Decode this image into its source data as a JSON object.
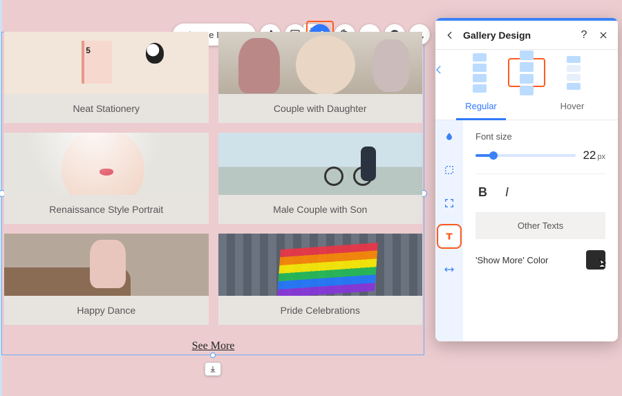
{
  "toolbar": {
    "change_images": "Change Images"
  },
  "gallery": {
    "items": [
      {
        "caption": "Neat Stationery"
      },
      {
        "caption": "Couple with Daughter"
      },
      {
        "caption": "Renaissance Style Portrait"
      },
      {
        "caption": "Male Couple with Son"
      },
      {
        "caption": "Happy Dance"
      },
      {
        "caption": "Pride Celebrations"
      }
    ],
    "see_more": "See More"
  },
  "panel": {
    "title": "Gallery Design",
    "tabs": {
      "regular": "Regular",
      "hover": "Hover"
    },
    "font_size_label": "Font size",
    "font_size_value": "22",
    "font_size_unit": "px",
    "other_texts": "Other Texts",
    "show_more_color_label": "'Show More' Color",
    "show_more_color": "#2b2b2b"
  }
}
